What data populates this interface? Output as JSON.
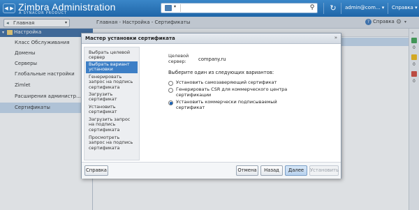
{
  "header": {
    "title": "Zimbra Administration",
    "subtitle": "A SYNACOR PRODUCT",
    "nav_back": "◀",
    "nav_forward": "▶",
    "search_placeholder": "",
    "user": "admin@com...",
    "help": "Справка",
    "dropdown_arrow": "▾",
    "refresh_icon": "↻",
    "search_icon": "⚲"
  },
  "left_nav": {
    "home_label": "Главная",
    "root_label": "Настройка",
    "items": [
      {
        "label": "Класс Обслуживания"
      },
      {
        "label": "Домены"
      },
      {
        "label": "Серверы"
      },
      {
        "label": "Глобальные настройки"
      },
      {
        "label": "Zimlet"
      },
      {
        "label": "Расширения администр..."
      },
      {
        "label": "Сертификаты",
        "selected": true
      }
    ]
  },
  "main": {
    "breadcrumb": "Главная - Настройка - Сертификаты",
    "help_label": "Справка"
  },
  "right_strip": {
    "counts": [
      "0",
      "0",
      "0"
    ],
    "colors": [
      "#2f9b45",
      "#f0b400",
      "#d23a2a"
    ]
  },
  "dialog": {
    "title": "Мастер установки сертификата",
    "close_icon": "»",
    "steps": [
      {
        "label": "Выбрать целевой сервер"
      },
      {
        "label": "Выбрать вариант установки",
        "active": true
      },
      {
        "label": "Генерировать запрос на подпись сертификата"
      },
      {
        "label": "Загрузить сертификат"
      },
      {
        "label": "Установить сертификат"
      },
      {
        "label": "Загрузить запрос на подпись сертификата"
      },
      {
        "label": "Просмотреть запрос на подпись сертификата"
      }
    ],
    "target_label": "Целевой сервер:",
    "target_value": "company.ru",
    "prompt": "Выберите один из следующих вариантов:",
    "options": [
      {
        "label": "Установить самозаверяющий сертификат",
        "selected": false
      },
      {
        "label": "Генерировать CSR для коммерческого центра сертификации",
        "selected": false
      },
      {
        "label": "Установить коммерчески подписываемый сертификат",
        "selected": true
      }
    ],
    "buttons": {
      "help": "Справка",
      "cancel": "Отмена",
      "back": "Назад",
      "next": "Далее",
      "install": "Установить"
    }
  }
}
